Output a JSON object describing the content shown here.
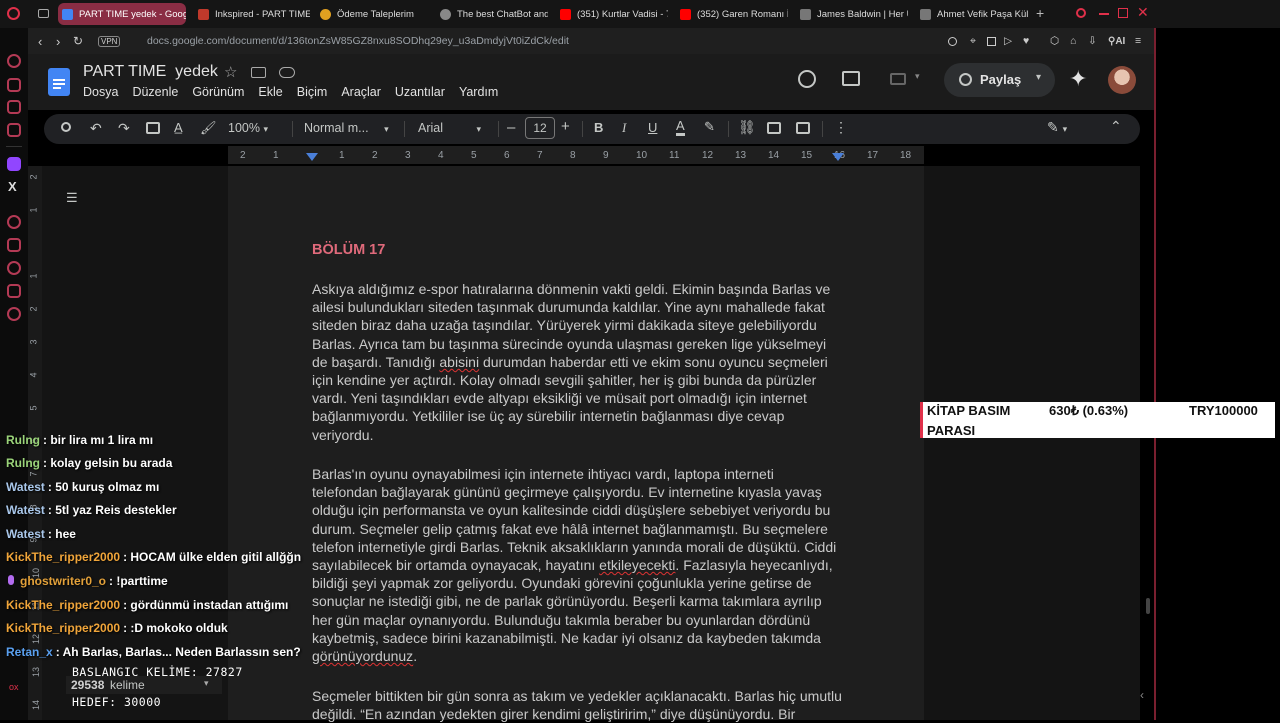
{
  "browser": {
    "tabs": [
      {
        "label": "PART TIME yedek - Google",
        "color": "#4285f4",
        "active": true
      },
      {
        "label": "Inkspired - PART TIME",
        "color": "#c0392b"
      },
      {
        "label": "Ödeme Taleplerim",
        "color": "#e0a020"
      },
      {
        "label": "The best ChatBot and",
        "color": "#888888"
      },
      {
        "label": "(351) Kurtlar Vadisi - 7",
        "color": "#ff0000"
      },
      {
        "label": "(352) Garen Romanı İn",
        "color": "#ff0000"
      },
      {
        "label": "James Baldwin | Her U",
        "color": "#777777"
      },
      {
        "label": "Ahmet Vefik Paşa Kültü",
        "color": "#777777"
      }
    ],
    "new_tab": "+",
    "vpn": "VPN",
    "url": "docs.google.com/document/d/136tonZsW85GZ8nxu8SODhq29ey_u3aDmdyjVt0iZdCk/edit",
    "ai_label": "AI"
  },
  "docs": {
    "title": "PART TIME  yedek",
    "menu": [
      "Dosya",
      "Düzenle",
      "Görünüm",
      "Ekle",
      "Biçim",
      "Araçlar",
      "Uzantılar",
      "Yardım"
    ],
    "share_label": "Paylaş",
    "zoom": "100%",
    "style": "Normal m...",
    "font": "Arial",
    "font_size": "12",
    "ruler_ticks": [
      "2",
      "1",
      "",
      "1",
      "2",
      "3",
      "4",
      "5",
      "6",
      "7",
      "8",
      "9",
      "10",
      "11",
      "12",
      "13",
      "14",
      "15",
      "16",
      "17",
      "18"
    ],
    "left_ruler_ticks": [
      "2",
      "1",
      "",
      "1",
      "2",
      "3",
      "4",
      "5",
      "6",
      "7",
      "8",
      "9",
      "10",
      "11",
      "12",
      "13",
      "14"
    ]
  },
  "document": {
    "chapter": "BÖLÜM 17",
    "p1": "Askıya aldığımız e-spor hatıralarına dönmenin vakti geldi. Ekimin başında Barlas ve ailesi bulundukları siteden taşınmak durumunda kaldılar. Yine aynı mahallede fakat siteden biraz daha uzağa taşındılar. Yürüyerek yirmi dakikada siteye gelebiliyordu Barlas. Ayrıca tam bu taşınma sürecinde oyunda ulaşması gereken lige yükselmeyi de başardı. Tanıdığı",
    "p1_err": "abisini",
    "p1_b": "durumdan haberdar etti ve ekim sonu oyuncu seçmeleri için kendine yer açtırdı. Kolay olmadı sevgili şahitler, her iş gibi bunda da pürüzler vardı. Yeni taşındıkları evde altyapı eksikliği ve müsait port olmadığı için internet bağlanmıyordu. Yetkililer ise üç ay sürebilir internetin bağlanması diye cevap veriyordu.",
    "p2": "Barlas'ın oyunu oynayabilmesi için internete ihtiyacı vardı, laptopa interneti telefondan bağlayarak gününü geçirmeye çalışıyordu. Ev internetine kıyasla yavaş olduğu için performansta ve oyun kalitesinde ciddi düşüşlere sebebiyet veriyordu bu durum. Seçmeler gelip çatmış fakat eve hâlâ internet bağlanmamıştı. Bu seçmelere telefon internetiyle girdi Barlas. Teknik aksaklıkların yanında morali de düşüktü. Ciddi sayılabilecek bir ortamda oynayacak, hayatını",
    "p2_err": "etkileyecekti",
    "p2_b": ". Fazlasıyla heyecanlıydı, bildiği şeyi yapmak zor geliyordu. Oyundaki görevini çoğunlukla yerine getirse de sonuçlar ne istediği gibi, ne de parlak görünüyordu. Beşerli karma takımlara ayrılıp her gün maçlar oynanıyordu. Bulunduğu takımla beraber bu oyunlardan dördünü kaybetmiş, sadece birini kazanabilmişti. Ne kadar iyi olsanız da kaybeden takımda",
    "p2_err2": "görünüyordunuz",
    "p2_end": ".",
    "p3": "Seçmeler bittikten bir gün sonra as takım ve yedekler açıklanacaktı. Barlas hiç umutlu değildi. “En azından yedekten girer kendimi geliştiririm,” diye düşünüyordu. Bir"
  },
  "chat": [
    {
      "user": "Rulng",
      "msg": ": bir lira mı 1 lira mı",
      "color": "#9bd47a"
    },
    {
      "user": "Rulng",
      "msg": ": kolay gelsin bu arada",
      "color": "#9bd47a"
    },
    {
      "user": "Watest",
      "msg": ": 50 kuruş olmaz mı",
      "color": "#a9c7ea"
    },
    {
      "user": "Watest",
      "msg": ": 5tl yaz Reis destekler",
      "color": "#a9c7ea"
    },
    {
      "user": "Watest",
      "msg": ": hee",
      "color": "#a9c7ea"
    },
    {
      "user": "KickThe_ripper2000",
      "msg": ": HOCAM ülke elden gitil allğğn",
      "color": "#f0a53a"
    },
    {
      "user": "ghostwriter0_o",
      "msg": ": !parttime",
      "color": "#e3a13a"
    },
    {
      "user": "KickThe_ripper2000",
      "msg": ": gördünmü instadan attığımı",
      "color": "#f0a53a"
    },
    {
      "user": "KickThe_ripper2000",
      "msg": ": :D mokoko olduk",
      "color": "#f0a53a"
    },
    {
      "user": "Retan_x",
      "msg": ": Ah Barlas, Barlas... Neden Barlassın sen?",
      "color": "#5aa0f0"
    }
  ],
  "overlay": {
    "start_label": "BAŞLANGIÇ KELİME: 27827",
    "word_count": "29538",
    "word_unit": "kelime",
    "target_label": "HEDEF: 30000"
  },
  "donation": {
    "title_line1": "KİTAP BASIM",
    "title_line2": "PARASI",
    "amount": "630₺ (0.63%)",
    "goal": "TRY100000",
    "progress": 0.0063
  }
}
